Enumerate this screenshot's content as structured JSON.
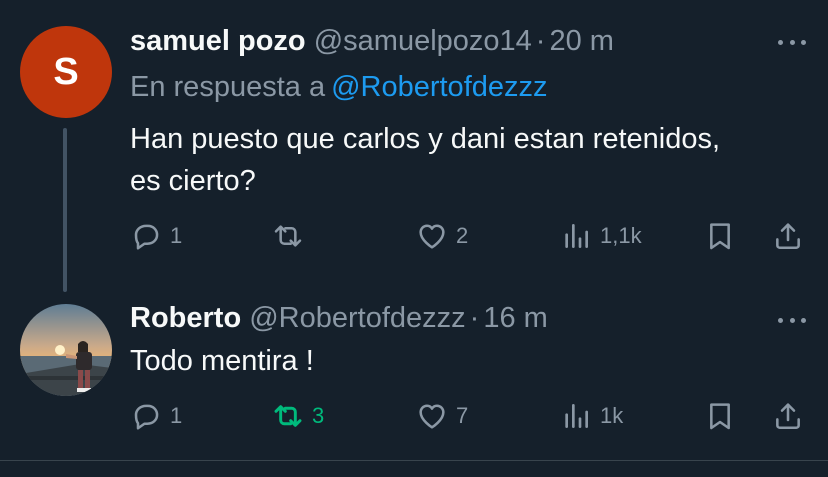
{
  "tweets": [
    {
      "avatar_letter": "S",
      "avatar_color": "#bf360c",
      "name": "samuel pozo",
      "handle": "@samuelpozo14",
      "separator": "·",
      "time": "20 m",
      "reply_prefix": "En respuesta a",
      "reply_mention": "@Robertofdezzz",
      "text_lines": [
        "Han puesto que carlos y dani estan retenidos,",
        "es cierto?"
      ],
      "replies": "1",
      "retweets": "",
      "likes": "2",
      "views": "1,1k"
    },
    {
      "name": "Roberto",
      "handle": "@Robertofdezzz",
      "separator": "·",
      "time": "16 m",
      "text_lines": [
        "Todo mentira !"
      ],
      "replies": "1",
      "retweets": "3",
      "likes": "7",
      "views": "1k"
    }
  ],
  "icons": {
    "reply": "reply-icon",
    "retweet": "retweet-icon",
    "like": "heart-icon",
    "views": "views-icon",
    "bookmark": "bookmark-icon",
    "share": "share-icon",
    "more": "more-icon"
  },
  "colors": {
    "background": "#15202b",
    "text": "#f7f9f9",
    "secondary": "#8b98a5",
    "link": "#1d9bf0",
    "retweet_active": "#00ba7c"
  }
}
